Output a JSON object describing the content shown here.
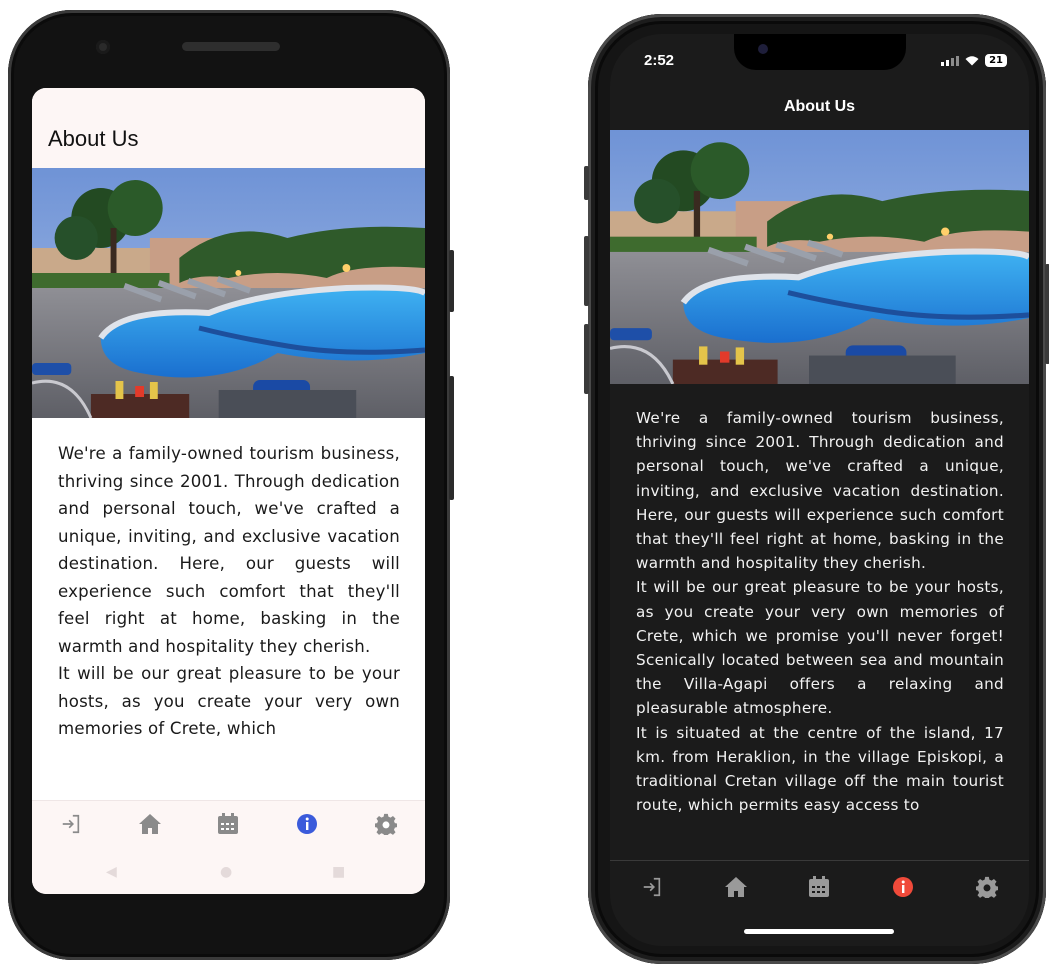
{
  "android": {
    "header": {
      "title": "About Us"
    },
    "paragraphs": [
      "We're a family-owned tourism business, thriving since 2001. Through dedication and personal touch, we've crafted a unique, inviting, and exclusive vacation destination. Here, our guests will experience such comfort that they'll feel right at home, basking in the warmth and hospitality they cherish.",
      "It will be our great pleasure to be your hosts, as you create your very own memories of Crete, which"
    ],
    "nav": {
      "items": [
        "login-icon",
        "home-icon",
        "calendar-icon",
        "info-icon",
        "gear-icon"
      ],
      "active": "info-icon",
      "active_color": "#3b5bdb"
    }
  },
  "iphone": {
    "status": {
      "time": "2:52",
      "battery": "21"
    },
    "header": {
      "title": "About Us"
    },
    "paragraphs": [
      "We're a family-owned tourism business, thriving since 2001. Through dedication and personal touch, we've crafted a unique, inviting, and exclusive vacation destination. Here, our guests will experience such comfort that they'll feel right at home, basking in the warmth and hospitality they cherish.",
      "It will be our great pleasure to be your hosts, as you create your very own memories of Crete, which we promise you'll never forget! Scenically located between sea and mountain the Villa-Agapi offers a relaxing and pleasurable atmosphere.",
      "It is situated at the centre of the island, 17 km. from Heraklion, in the village Episkopi, a traditional Cretan village off the main tourist route, which permits easy access to"
    ],
    "nav": {
      "items": [
        "login-icon",
        "home-icon",
        "calendar-icon",
        "info-icon",
        "gear-icon"
      ],
      "active": "info-icon",
      "active_color": "#f04a3a"
    }
  }
}
